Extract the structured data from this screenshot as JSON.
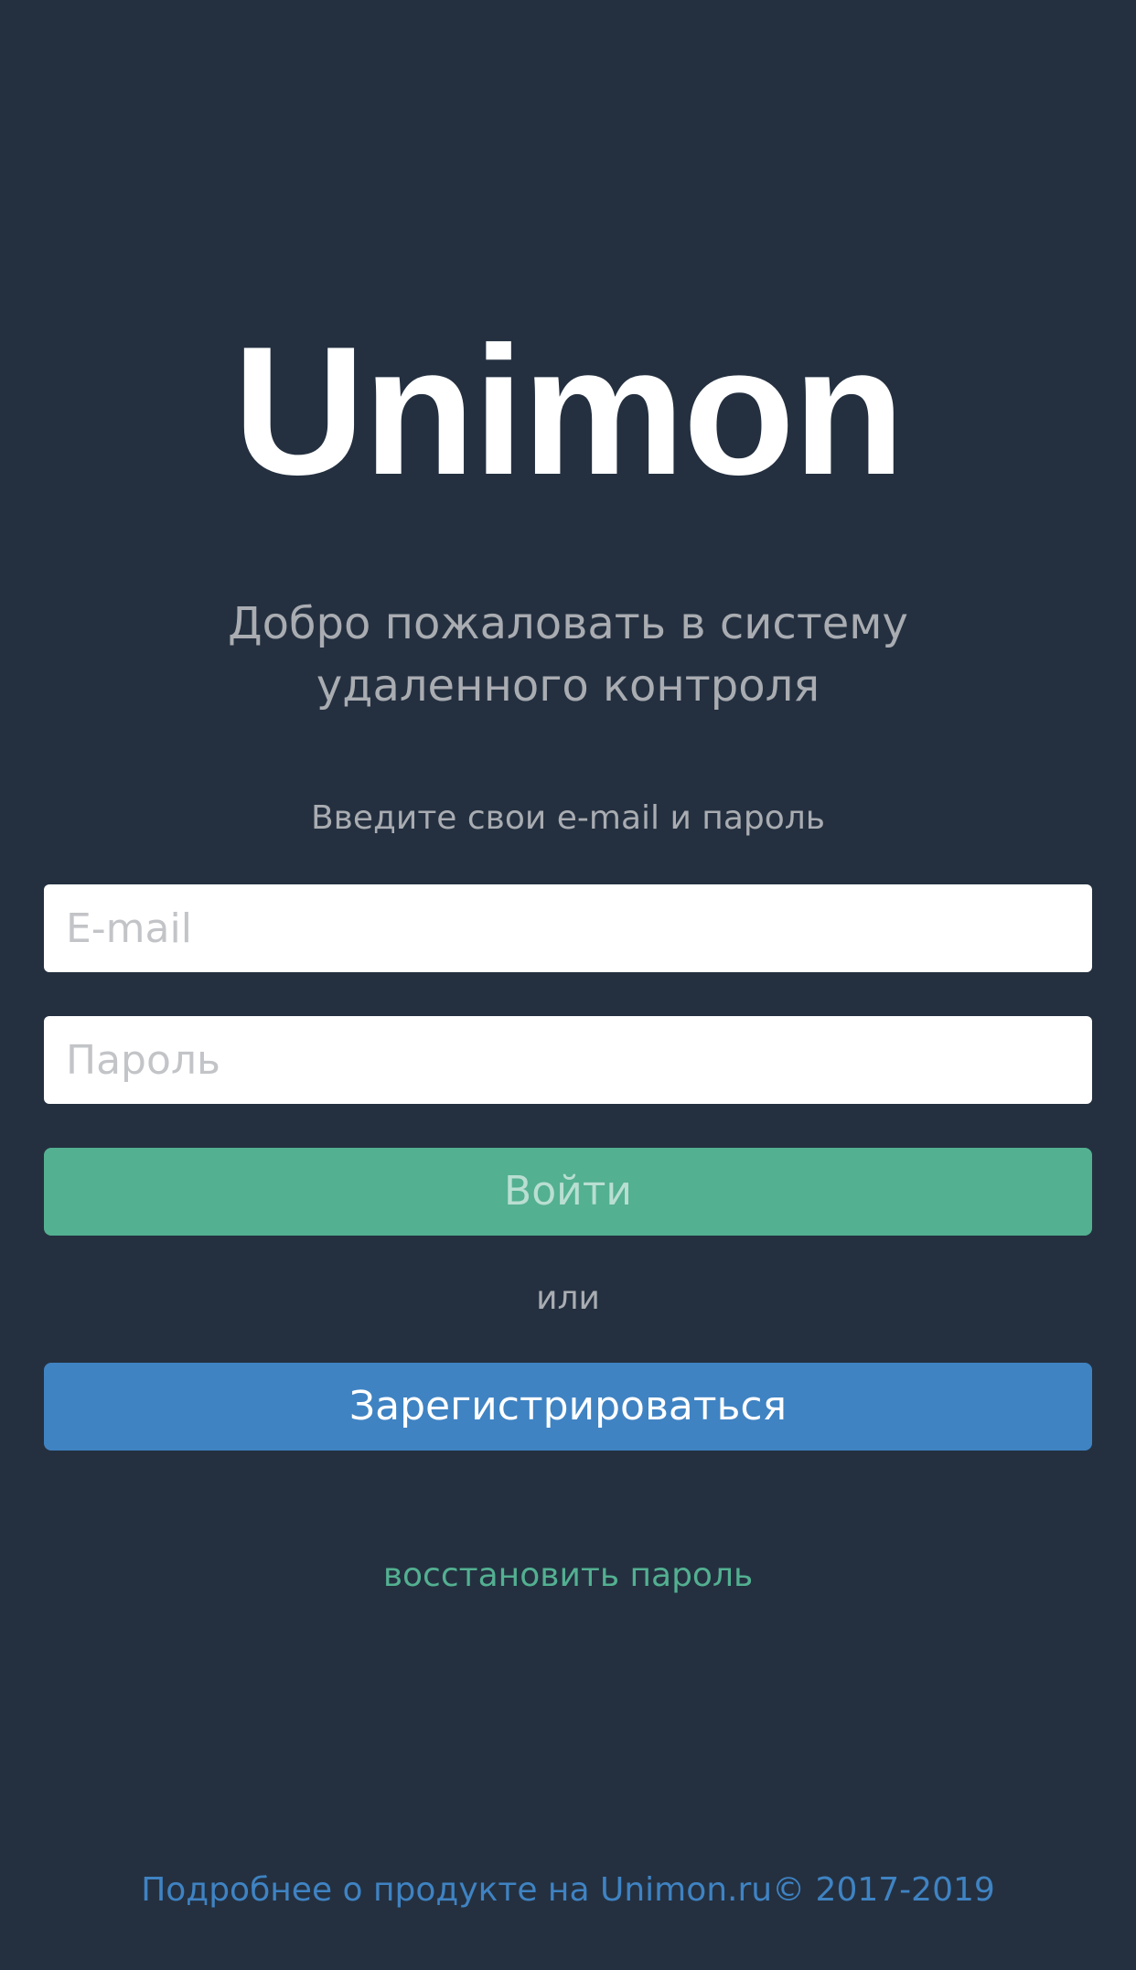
{
  "app": {
    "logo": "Unimon"
  },
  "welcome": {
    "line1": "Добро пожаловать в систему",
    "line2": "удаленного контроля"
  },
  "form": {
    "hint": "Введите свои e-mail и пароль",
    "email_placeholder": "E-mail",
    "email_value": "",
    "password_placeholder": "Пароль",
    "password_value": "",
    "login_label": "Войти",
    "or_label": "или",
    "register_label": "Зарегистрироваться",
    "restore_label": "восстановить пароль"
  },
  "footer": {
    "text": "Подробнее о продукте на Unimon.ru© 2017-2019"
  },
  "colors": {
    "background": "#243040",
    "accent_green": "#53b091",
    "accent_blue": "#3f83c3",
    "muted_text": "#a9acb1"
  }
}
